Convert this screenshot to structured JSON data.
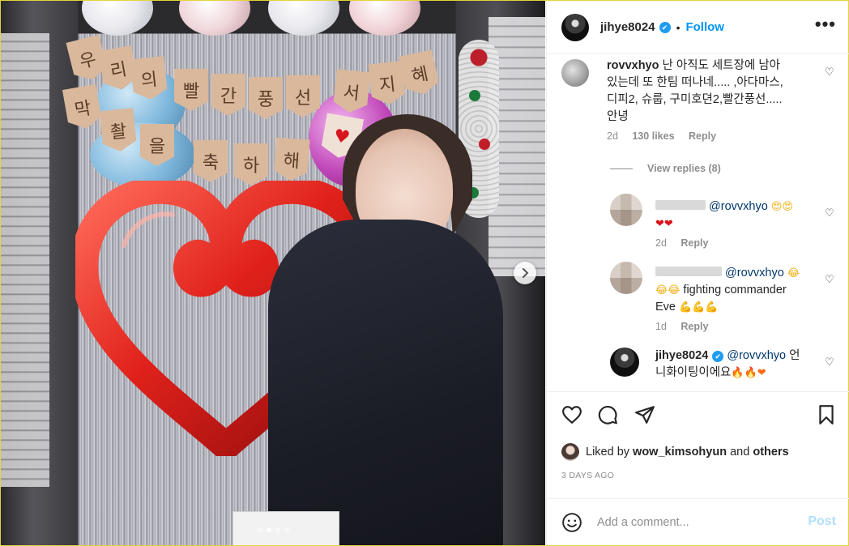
{
  "header": {
    "username": "jihye8024",
    "separator": "•",
    "follow_label": "Follow",
    "more_label": "•••"
  },
  "photo": {
    "alt_scene": "woman standing beside a red heart balloon and pennant banner",
    "banner_letters_row1": [
      "우",
      "리",
      "의",
      "빨",
      "간",
      "풍",
      "선",
      "서",
      "지",
      "혜"
    ],
    "banner_letters_row2": [
      "막",
      "촬",
      "을"
    ],
    "banner_letters_row3": [
      "축",
      "하",
      "해"
    ],
    "next_icon": "chevron-right-icon",
    "carousel": {
      "total": 4,
      "active_index": 1
    }
  },
  "comments": [
    {
      "username": "rovvxhyo",
      "text_line1": "난 아직도 세트장에 남아",
      "text_line2": "있는데 또 한팀 떠나네..... ,아다마스,",
      "text_line3": "디피2, 슈룹, 구미호뎐2,빨간풍선.....",
      "text_line4": "안녕",
      "time": "2d",
      "likes": "130 likes",
      "reply": "Reply",
      "view_replies": "View replies (8)"
    },
    {
      "username_hidden": true,
      "mention": "@rovvxhyo",
      "emoji_line1": "😍😍",
      "emoji_line2": "❤❤",
      "time": "2d",
      "reply": "Reply"
    },
    {
      "username_hidden": true,
      "mention": "@rovvxhyo",
      "emoji_line1": "😂",
      "emoji_line2_prefix": "😂😂",
      "text_line2": "fighting commander",
      "text_line3": "Eve",
      "emoji_line3": "💪💪💪",
      "time": "1d",
      "reply": "Reply"
    },
    {
      "username": "jihye8024",
      "mention": "@rovvxhyo",
      "text_line1": "언",
      "text_line2": "니화이팅이에요",
      "emoji_line2": "🔥🔥❤",
      "verified": true
    }
  ],
  "actions": {
    "like_icon": "heart-outline-icon",
    "comment_icon": "speech-bubble-icon",
    "share_icon": "paper-plane-icon",
    "save_icon": "bookmark-icon"
  },
  "likes_summary": {
    "prefix": "Liked by",
    "user": "wow_kimsohyun",
    "and": "and",
    "others": "others"
  },
  "timestamp": "3 DAYS AGO",
  "add_comment": {
    "emoji_icon": "smiley-icon",
    "placeholder": "Add a comment...",
    "post_label": "Post"
  },
  "colors": {
    "accent": "#0095f6",
    "verified": "#1f9bf0",
    "post_disabled": "#b2dffc",
    "muted": "#8e8e8e"
  }
}
